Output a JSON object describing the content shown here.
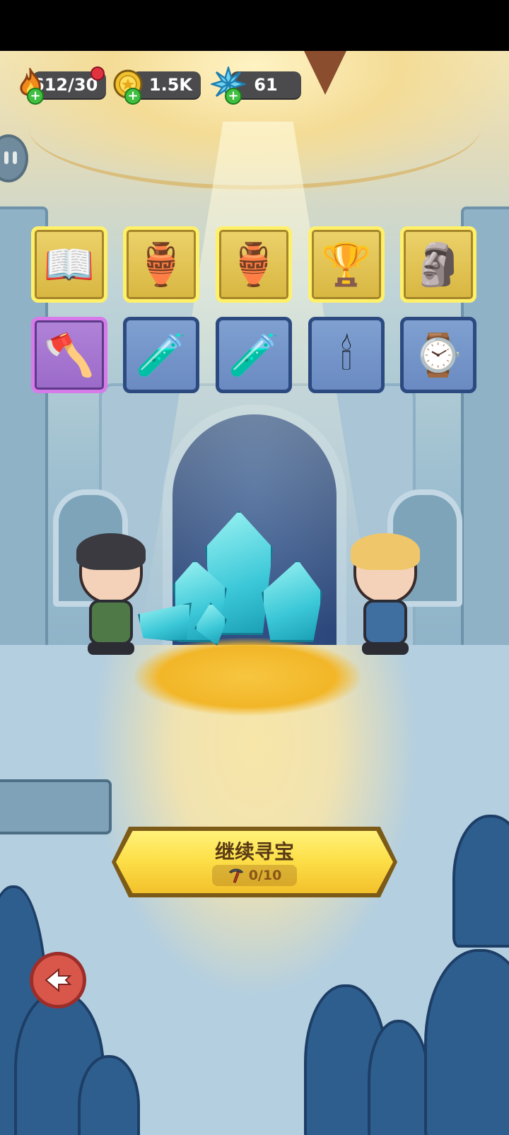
{
  "hud": {
    "energy": {
      "value": "612/30",
      "icon": "flame-icon"
    },
    "coins": {
      "value": "1.5K",
      "icon": "coin-icon"
    },
    "gems": {
      "value": "61",
      "icon": "snow-crystal-icon"
    }
  },
  "items": {
    "row1": [
      {
        "icon": "spellbook-icon",
        "glyph": "📖",
        "rarity": "gold"
      },
      {
        "icon": "treasure-vase-icon",
        "glyph": "🏺",
        "rarity": "gold"
      },
      {
        "icon": "treasure-vase-icon",
        "glyph": "🏺",
        "rarity": "gold"
      },
      {
        "icon": "chalice-icon",
        "glyph": "🏆",
        "rarity": "gold"
      },
      {
        "icon": "totem-icon",
        "glyph": "🗿",
        "rarity": "gold"
      }
    ],
    "row2": [
      {
        "icon": "axe-icon",
        "glyph": "🪓",
        "rarity": "purple"
      },
      {
        "icon": "potion-icon",
        "glyph": "🧪",
        "rarity": "blue"
      },
      {
        "icon": "potion-icon",
        "glyph": "🧪",
        "rarity": "blue"
      },
      {
        "icon": "candle-icon",
        "glyph": "🕯",
        "rarity": "blue"
      },
      {
        "icon": "pocket-watch-icon",
        "glyph": "⌚",
        "rarity": "blue"
      }
    ]
  },
  "continue_button": {
    "label": "继续寻宝",
    "progress": "0/10",
    "icon": "pickaxe-icon"
  },
  "colors": {
    "accent": "#fde04a",
    "back": "#d9574a"
  }
}
